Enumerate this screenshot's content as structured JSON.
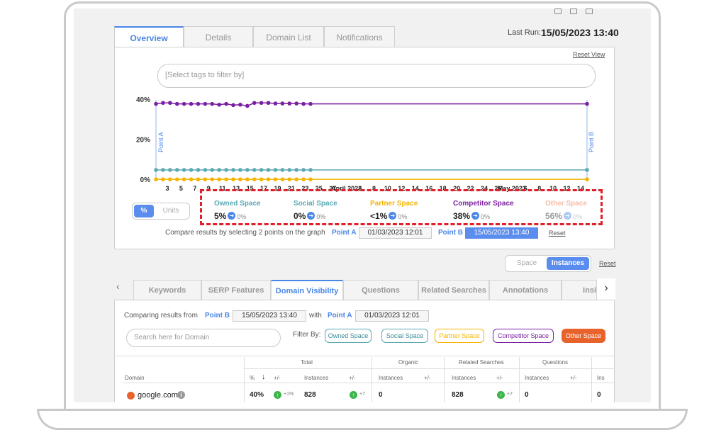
{
  "main_tabs": [
    {
      "label": "Overview",
      "active": true
    },
    {
      "label": "Details",
      "active": false
    },
    {
      "label": "Domain List",
      "active": false
    },
    {
      "label": "Notifications",
      "active": false
    }
  ],
  "last_run": {
    "label": "Last Run:",
    "value": "15/05/2023 13:40"
  },
  "reset_view": "Reset View",
  "tag_filter": {
    "placeholder": "[Select tags to filter by]"
  },
  "chart_data": {
    "type": "line",
    "y_ticks": [
      "40%",
      "20%",
      "0%"
    ],
    "ylim": [
      0,
      40
    ],
    "x_tick_labels": [
      "3",
      "5",
      "7",
      "9",
      "11",
      "13",
      "15",
      "17",
      "19",
      "21",
      "23",
      "25",
      "27",
      "April 2023",
      "6",
      "8",
      "10",
      "12",
      "14",
      "16",
      "18",
      "20",
      "22",
      "24",
      "26",
      "May 2023",
      "6",
      "8",
      "10",
      "12",
      "14"
    ],
    "marker_a": "Point A",
    "marker_b": "Point B",
    "series": [
      {
        "name": "Competitor Space",
        "color": "#7b1fa2",
        "y": [
          38,
          38.5,
          38.5,
          38,
          38,
          38,
          38,
          38,
          38,
          37.6,
          38,
          37.4,
          37.6,
          37,
          38.5,
          38.5,
          38.5,
          38.2,
          38.2,
          38.2,
          38.2,
          38,
          38,
          38
        ]
      },
      {
        "name": "Owned Space",
        "color": "#5aa9b5",
        "y": [
          5,
          5,
          5,
          5,
          5,
          5,
          5,
          5,
          5,
          5,
          5,
          5,
          5,
          5,
          5,
          5,
          5,
          5,
          5,
          5,
          5,
          5,
          5,
          5
        ]
      },
      {
        "name": "Partner Space",
        "color": "#f4b400",
        "y": [
          0.3,
          0.3,
          0.3,
          0.3,
          0.3,
          0.3,
          0.3,
          0.3,
          0.3,
          0.3,
          0.3,
          0.3,
          0.3,
          0.3,
          0.3,
          0.3,
          0.3,
          0.3,
          0.3,
          0.3,
          0.3,
          0.3,
          0.3,
          0.3
        ]
      }
    ]
  },
  "unit_toggle": {
    "percent": "%",
    "units": "Units"
  },
  "metrics": [
    {
      "label": "Owned Space",
      "value": "5%",
      "delta": "0%",
      "color": "#5aa9b5",
      "faded": false
    },
    {
      "label": "Social Space",
      "value": "0%",
      "delta": "0%",
      "color": "#5aa9b5",
      "faded": false
    },
    {
      "label": "Partner Space",
      "value": "<1%",
      "delta": "0%",
      "color": "#f4b400",
      "faded": false
    },
    {
      "label": "Competitor Space",
      "value": "38%",
      "delta": "0%",
      "color": "#7b1fa2",
      "faded": false
    },
    {
      "label": "Other Space",
      "value": "56%",
      "delta": "0%",
      "color": "#f4a58a",
      "faded": true
    }
  ],
  "compare": {
    "text": "Compare results by selecting 2 points on the graph",
    "point_a_label": "Point A",
    "point_a_date": "01/03/2023 12:01",
    "point_b_label": "Point B",
    "point_b_date": "15/05/2023 13:40",
    "reset": "Reset"
  },
  "space_toggle": {
    "space": "Space",
    "instances": "Instances",
    "reset": "Reset"
  },
  "sub_tabs": [
    {
      "label": "Keywords",
      "active": false
    },
    {
      "label": "SERP Features",
      "active": false
    },
    {
      "label": "Domain Visibility",
      "active": true
    },
    {
      "label": "Questions",
      "active": false
    },
    {
      "label": "Related Searches",
      "active": false
    },
    {
      "label": "Annotations",
      "active": false
    },
    {
      "label": "Insi",
      "active": false
    }
  ],
  "comparing": {
    "prefix": "Comparing results from",
    "point_b_label": "Point B",
    "point_b_date": "15/05/2023 13:40",
    "with": "with",
    "point_a_label": "Point A",
    "point_a_date": "01/03/2023 12:01"
  },
  "domain_search": {
    "placeholder": "Search here for Domain"
  },
  "filter_by": {
    "label": "Filter By:",
    "pills": [
      {
        "label": "Owned Space",
        "color": "#5aa9b5",
        "filled": false
      },
      {
        "label": "Social Space",
        "color": "#5aa9b5",
        "filled": false
      },
      {
        "label": "Partner Space",
        "color": "#f4b400",
        "filled": false
      },
      {
        "label": "Competitor Space",
        "color": "#7b1fa2",
        "filled": false
      },
      {
        "label": "Other Space",
        "color": "#e8622c",
        "filled": true
      }
    ]
  },
  "table": {
    "groups": [
      "Total",
      "Organic",
      "Related Searches",
      "Questions"
    ],
    "columns": [
      "Domain",
      "%",
      "+/-",
      "Instances",
      "+/-",
      "Instances",
      "+/-",
      "Instances",
      "+/-",
      "Instances",
      "+/-",
      "Ins"
    ],
    "rows": [
      {
        "domain": "google.com",
        "pct": "40%",
        "pct_delta": "+1%",
        "instances": "828",
        "inst_delta": "+7",
        "organic": "0",
        "related": "828",
        "related_delta": "+7",
        "questions": "0",
        "extra": "0"
      }
    ]
  }
}
